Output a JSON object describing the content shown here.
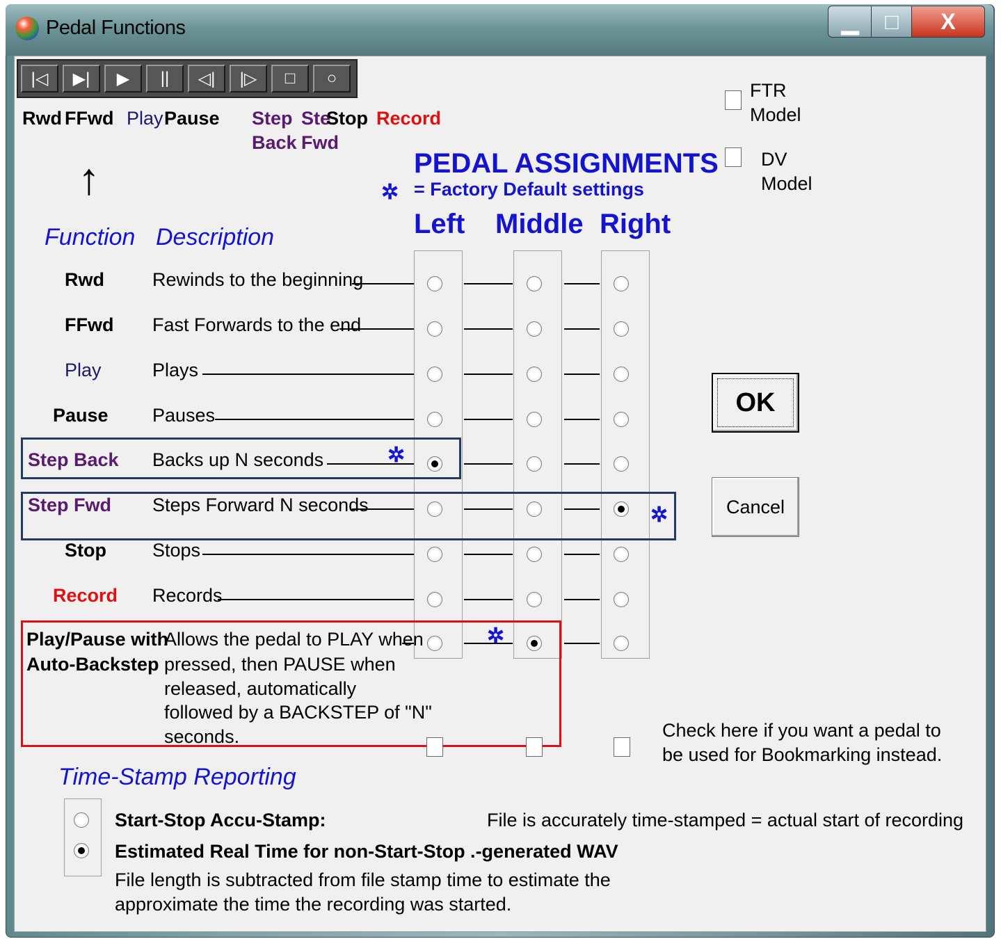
{
  "window": {
    "title": "Pedal Functions",
    "min_glyph": "▁",
    "max_glyph": "□",
    "close_glyph": "X"
  },
  "toolbar": [
    {
      "name": "rewind-icon",
      "glyph": "|◁"
    },
    {
      "name": "fast-forward-icon",
      "glyph": "▶|"
    },
    {
      "name": "play-icon",
      "glyph": "▶"
    },
    {
      "name": "pause-icon",
      "glyph": "||"
    },
    {
      "name": "step-back-icon",
      "glyph": "◁|"
    },
    {
      "name": "step-forward-icon",
      "glyph": "|▷"
    },
    {
      "name": "stop-icon",
      "glyph": "□"
    },
    {
      "name": "record-icon",
      "glyph": "○"
    }
  ],
  "toolbar_labels": {
    "rwd": "Rwd",
    "ffwd": "FFwd",
    "play": "Play",
    "pause": "Pause",
    "step_back_1": "Step",
    "step_back_2": "Back",
    "step_fwd_1": "Ste",
    "step_fwd_2": "Fwd",
    "stop": "Stop",
    "record": "Record"
  },
  "arrow": "↑",
  "heading": {
    "title": "PEDAL ASSIGNMENTS",
    "legend_symbol": "✲",
    "legend_text": "= Factory Default settings"
  },
  "columns": {
    "function": "Function",
    "description": "Description",
    "left": "Left",
    "middle": "Middle",
    "right": "Right"
  },
  "models": {
    "ftr_1": "FTR",
    "ftr_2": "Model",
    "dv_1": "DV",
    "dv_2": "Model"
  },
  "rows": [
    {
      "function": "Rwd",
      "description": "Rewinds to the beginning",
      "selected": "none"
    },
    {
      "function": "FFwd",
      "description": "Fast Forwards to the end",
      "selected": "none"
    },
    {
      "function": "Play",
      "description": "Plays",
      "selected": "none"
    },
    {
      "function": "Pause",
      "description": "Pauses",
      "selected": "none"
    },
    {
      "function": "Step Back",
      "description": "Backs up N seconds",
      "selected": "left"
    },
    {
      "function": "Step Fwd",
      "description": "Steps Forward N seconds",
      "selected": "right"
    },
    {
      "function": "Stop",
      "description": "Stops",
      "selected": "none"
    },
    {
      "function": "Record",
      "description": "Records",
      "selected": "none"
    },
    {
      "function": "Play/Pause with",
      "description": "Allows the pedal to PLAY when",
      "selected": "middle"
    }
  ],
  "playpause_extra": {
    "function_line2": "Auto-Backstep",
    "desc_line2": "pressed, then PAUSE when",
    "desc_line3": "released, automatically",
    "desc_line4": "followed by a BACKSTEP of \"N\"",
    "desc_line5": "seconds."
  },
  "bookmark": {
    "line1": "Check here if you want a pedal to",
    "line2": "be used for Bookmarking instead."
  },
  "timestamp": {
    "title": "Time-Stamp Reporting",
    "opt1_label": "Start-Stop  Accu-Stamp:",
    "opt1_desc": "File is accurately time-stamped = actual start of recording",
    "opt2_label": "Estimated Real Time for non-Start-Stop .-generated  WAV",
    "opt2_desc1": "File length is subtracted from file stamp time to estimate the",
    "opt2_desc2": "approximate the  time the recording was started.",
    "selected": "opt2"
  },
  "buttons": {
    "ok": "OK",
    "cancel": "Cancel"
  }
}
